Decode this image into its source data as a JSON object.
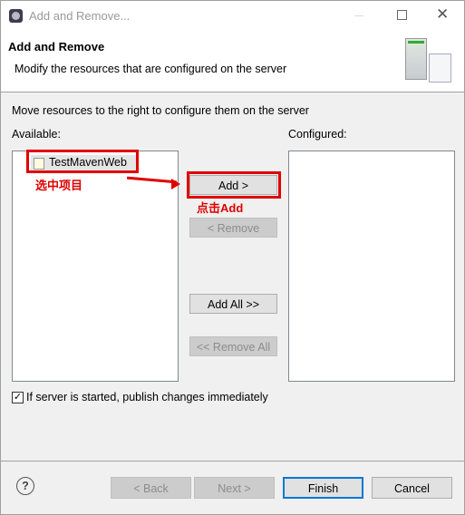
{
  "window": {
    "title": "Add and Remove...",
    "controls": [
      "minimize",
      "maximize",
      "close"
    ]
  },
  "header": {
    "title": "Add and Remove",
    "description": "Modify the resources that are configured on the server",
    "icon": "server-icon"
  },
  "instructions": "Move resources to the right to configure them on the server",
  "available": {
    "label": "Available:",
    "items": [
      {
        "label": "TestMavenWeb",
        "icon": "web-project-icon"
      }
    ]
  },
  "configured": {
    "label": "Configured:",
    "items": []
  },
  "buttons": {
    "add": "Add >",
    "remove": "< Remove",
    "add_all": "Add All >>",
    "remove_all": "<< Remove All"
  },
  "publish_checkbox": {
    "label": "If server is started, publish changes immediately",
    "checked": true
  },
  "footer": {
    "back": "< Back",
    "next": "Next >",
    "finish": "Finish",
    "cancel": "Cancel"
  },
  "annotations": {
    "select_project": "选中项目",
    "click_add": "点击Add",
    "color": "#e00000"
  }
}
